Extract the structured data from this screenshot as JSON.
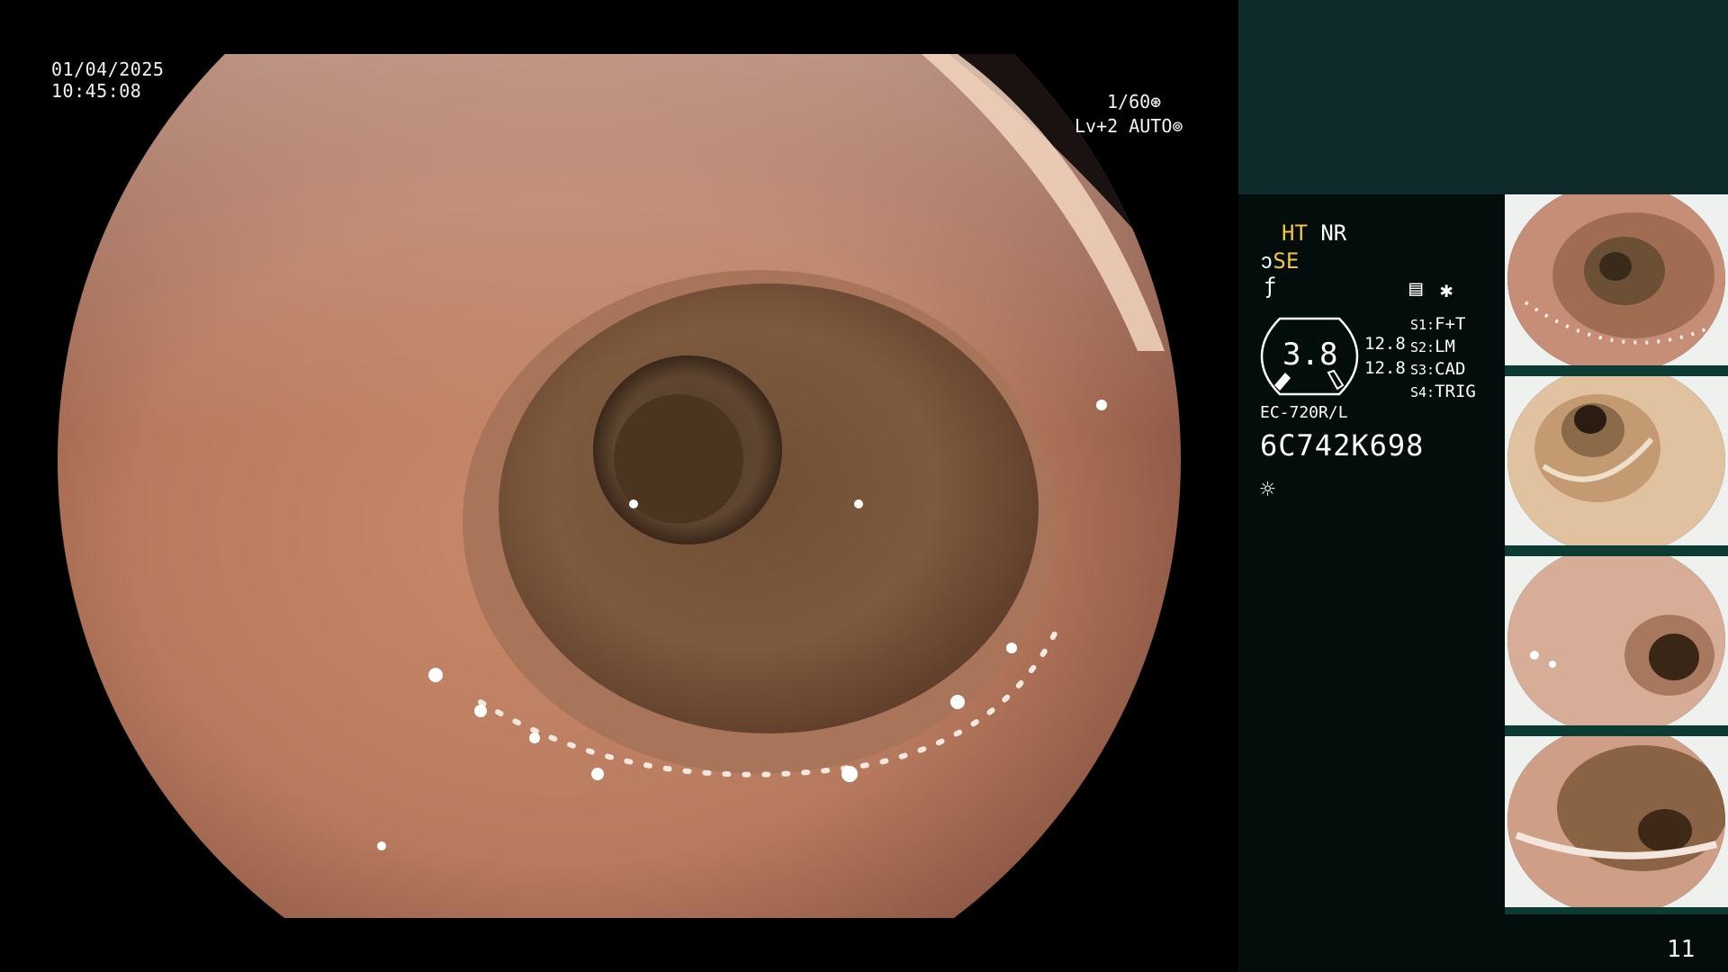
{
  "overlay": {
    "date": "01/04/2025",
    "time": "10:45:08",
    "shutter": "1/60",
    "shutter_icon": "⊛",
    "level": "Lv+2 AUTO",
    "level_icon": "⊚"
  },
  "status": {
    "ht": "HT",
    "nr": "NR",
    "se": "SE",
    "se_icon": "ↄ",
    "f_icon": "ƒ",
    "menu_icon": "▤",
    "star_icon": "✱"
  },
  "gauge": {
    "value": "3.8",
    "val_a": "12.8",
    "val_b": "12.8"
  },
  "switches": [
    {
      "key": "S1:",
      "value": "F+T"
    },
    {
      "key": "S2:",
      "value": "LM"
    },
    {
      "key": "S3:",
      "value": "CAD"
    },
    {
      "key": "S4:",
      "value": "TRIG"
    }
  ],
  "scope": {
    "model": "EC-720R/L",
    "serial": "6C742K698",
    "light_icon": "☼"
  },
  "page": {
    "number": "11"
  },
  "colors": {
    "panel_top": "#0f2a2a",
    "panel_bottom": "#030d0b",
    "accent_yellow": "#f4c43a",
    "thumb_strip": "#0b3b33"
  }
}
